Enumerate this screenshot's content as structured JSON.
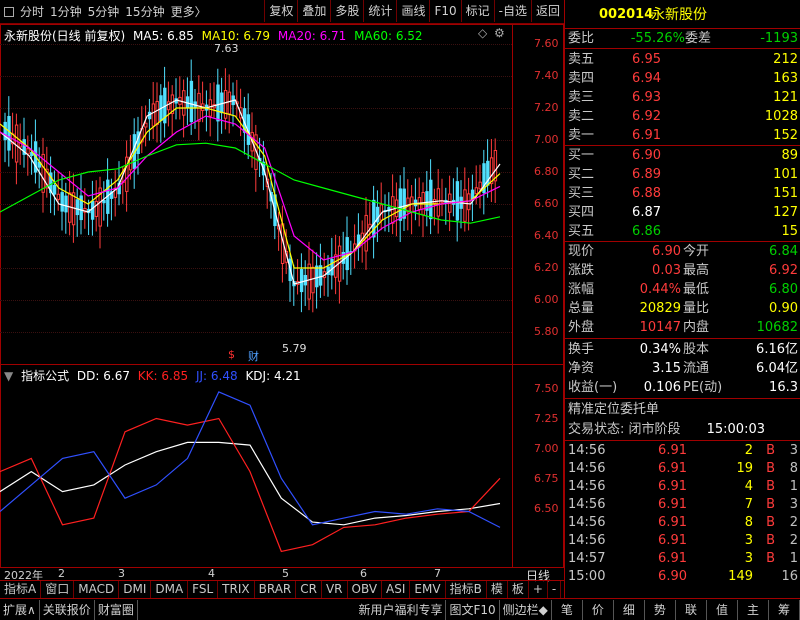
{
  "toolbar": {
    "left": [
      "分时",
      "1分钟",
      "5分钟",
      "15分钟",
      "更多〉"
    ],
    "right": [
      "复权",
      "叠加",
      "多股",
      "统计",
      "画线",
      "F10",
      "标记",
      "-自选",
      "返回"
    ]
  },
  "chart": {
    "title": "永新股份(日线 前复权)",
    "ma": [
      {
        "label": "MA5: 6.85",
        "color": "#ffffff"
      },
      {
        "label": "MA10: 6.79",
        "color": "#ffff00"
      },
      {
        "label": "MA20: 6.71",
        "color": "#ff00ff"
      },
      {
        "label": "MA60: 6.52",
        "color": "#00ff00"
      }
    ],
    "max_label": "7.63",
    "min_label": "5.79",
    "event_marks": [
      "$",
      "财"
    ],
    "y_ticks": [
      "7.60",
      "7.40",
      "7.20",
      "7.00",
      "6.80",
      "6.60",
      "6.40",
      "6.20",
      "6.00",
      "5.80"
    ]
  },
  "chart_data": {
    "type": "line",
    "title": "永新股份(日线 前复权)",
    "xlabel": "",
    "ylabel": "",
    "ylim": [
      5.8,
      7.6
    ],
    "x_labels": [
      "2022年",
      "2",
      "3",
      "4",
      "5",
      "6",
      "7"
    ],
    "series": [
      {
        "name": "MA5",
        "color": "#ffffff",
        "values": [
          7.05,
          6.9,
          6.6,
          6.55,
          6.7,
          7.15,
          7.25,
          7.2,
          7.25,
          6.8,
          6.1,
          6.15,
          6.3,
          6.55,
          6.6,
          6.62,
          6.6,
          6.85
        ]
      },
      {
        "name": "MA10",
        "color": "#ffff00",
        "values": [
          7.1,
          6.95,
          6.7,
          6.6,
          6.75,
          7.05,
          7.2,
          7.2,
          7.15,
          6.9,
          6.2,
          6.2,
          6.3,
          6.5,
          6.6,
          6.6,
          6.62,
          6.79
        ]
      },
      {
        "name": "MA20",
        "color": "#ff00ff",
        "values": [
          7.05,
          6.95,
          6.8,
          6.65,
          6.7,
          6.9,
          7.05,
          7.15,
          7.1,
          6.95,
          6.4,
          6.25,
          6.3,
          6.45,
          6.55,
          6.6,
          6.62,
          6.71
        ]
      },
      {
        "name": "MA60",
        "color": "#00ff00",
        "values": [
          6.55,
          6.65,
          6.75,
          6.8,
          6.82,
          6.9,
          6.97,
          6.98,
          6.95,
          6.85,
          6.75,
          6.7,
          6.65,
          6.6,
          6.55,
          6.5,
          6.48,
          6.52
        ]
      }
    ]
  },
  "indicator": {
    "title": "指标公式",
    "params": [
      {
        "label": "DD: 6.67",
        "color": "#ffffff"
      },
      {
        "label": "KK: 6.85",
        "color": "#ff2020"
      },
      {
        "label": "JJ: 6.48",
        "color": "#3050ff"
      },
      {
        "label": "KDJ: 4.21",
        "color": "#ffffff"
      }
    ],
    "y_ticks": [
      "7.50",
      "7.25",
      "7.00",
      "6.75",
      "6.50"
    ],
    "ylim": [
      6.25,
      7.65
    ],
    "series": [
      {
        "color": "#ffffff",
        "values": [
          6.75,
          6.9,
          6.75,
          6.8,
          6.95,
          7.05,
          7.12,
          7.12,
          7.1,
          6.7,
          6.52,
          6.5,
          6.55,
          6.57,
          6.6,
          6.62,
          6.66
        ]
      },
      {
        "color": "#ff2020",
        "values": [
          6.9,
          7.0,
          6.5,
          6.55,
          7.2,
          7.3,
          7.25,
          7.3,
          6.9,
          6.3,
          6.35,
          6.48,
          6.5,
          6.55,
          6.58,
          6.6,
          6.85
        ]
      },
      {
        "color": "#3050ff",
        "values": [
          6.6,
          6.8,
          7.0,
          7.05,
          6.7,
          6.8,
          7.0,
          7.5,
          7.4,
          6.85,
          6.5,
          6.55,
          6.6,
          6.58,
          6.62,
          6.6,
          6.48
        ]
      }
    ]
  },
  "x_axis": {
    "labels": [
      "2022年",
      "2",
      "3",
      "4",
      "5",
      "6",
      "7"
    ],
    "right_label": "日线"
  },
  "bottom_tabs": [
    "指标A",
    "窗口",
    "MACD",
    "DMI",
    "DMA",
    "FSL",
    "TRIX",
    "BRAR",
    "CR",
    "VR",
    "OBV",
    "ASI",
    "EMV",
    "指标B",
    "模",
    "板",
    "+",
    "-"
  ],
  "stock": {
    "code": "002014",
    "name": "永新股份"
  },
  "ratio": {
    "label1": "委比",
    "v1": "-55.26%",
    "label2": "委差",
    "v2": "-1193"
  },
  "sells": [
    {
      "label": "卖五",
      "price": "6.95",
      "vol": "212"
    },
    {
      "label": "卖四",
      "price": "6.94",
      "vol": "163"
    },
    {
      "label": "卖三",
      "price": "6.93",
      "vol": "121"
    },
    {
      "label": "卖二",
      "price": "6.92",
      "vol": "1028"
    },
    {
      "label": "卖一",
      "price": "6.91",
      "vol": "152"
    }
  ],
  "buys": [
    {
      "label": "买一",
      "price": "6.90",
      "vol": "89",
      "pc": "red"
    },
    {
      "label": "买二",
      "price": "6.89",
      "vol": "101",
      "pc": "red"
    },
    {
      "label": "买三",
      "price": "6.88",
      "vol": "151",
      "pc": "red"
    },
    {
      "label": "买四",
      "price": "6.87",
      "vol": "127",
      "pc": "white"
    },
    {
      "label": "买五",
      "price": "6.86",
      "vol": "15",
      "pc": "green"
    }
  ],
  "quote": [
    {
      "k1": "现价",
      "v1": "6.90",
      "c1": "red",
      "k2": "今开",
      "v2": "6.84",
      "c2": "green"
    },
    {
      "k1": "涨跌",
      "v1": "0.03",
      "c1": "red",
      "k2": "最高",
      "v2": "6.92",
      "c2": "red"
    },
    {
      "k1": "涨幅",
      "v1": "0.44%",
      "c1": "red",
      "k2": "最低",
      "v2": "6.80",
      "c2": "green"
    },
    {
      "k1": "总量",
      "v1": "20829",
      "c1": "yellow",
      "k2": "量比",
      "v2": "0.90",
      "c2": "yellow"
    },
    {
      "k1": "外盘",
      "v1": "10147",
      "c1": "red",
      "k2": "内盘",
      "v2": "10682",
      "c2": "green"
    }
  ],
  "fund": [
    {
      "k1": "换手",
      "v1": "0.34%",
      "k2": "股本",
      "v2": "6.16亿"
    },
    {
      "k1": "净资",
      "v1": "3.15",
      "k2": "流通",
      "v2": "6.04亿"
    },
    {
      "k1": "收益(一)",
      "v1": "0.106",
      "k2": "PE(动)",
      "v2": "16.3"
    }
  ],
  "precise_order": "精准定位委托单",
  "trade_status": {
    "label": "交易状态: 闭市阶段",
    "time": "15:00:03"
  },
  "ticks": [
    {
      "time": "14:56",
      "price": "6.91",
      "vol": "2",
      "side": "B",
      "n": "3"
    },
    {
      "time": "14:56",
      "price": "6.91",
      "vol": "19",
      "side": "B",
      "n": "8"
    },
    {
      "time": "14:56",
      "price": "6.91",
      "vol": "4",
      "side": "B",
      "n": "1"
    },
    {
      "time": "14:56",
      "price": "6.91",
      "vol": "7",
      "side": "B",
      "n": "3"
    },
    {
      "time": "14:56",
      "price": "6.91",
      "vol": "8",
      "side": "B",
      "n": "2"
    },
    {
      "time": "14:56",
      "price": "6.91",
      "vol": "3",
      "side": "B",
      "n": "2"
    },
    {
      "time": "14:57",
      "price": "6.91",
      "vol": "3",
      "side": "B",
      "n": "1"
    },
    {
      "time": "15:00",
      "price": "6.90",
      "vol": "149",
      "side": "",
      "n": "16"
    }
  ],
  "status_left": [
    "扩展∧",
    "关联报价",
    "财富圈"
  ],
  "status_mid": [
    "新用户福利专享",
    "图文F10",
    "侧边栏◆"
  ],
  "status_right": [
    "笔",
    "价",
    "细",
    "势",
    "联",
    "值",
    "主",
    "筹"
  ],
  "colors": {
    "up": "#ff3b3b",
    "down": "#00d000",
    "border": "#a00000",
    "accent": "#ffff00"
  }
}
